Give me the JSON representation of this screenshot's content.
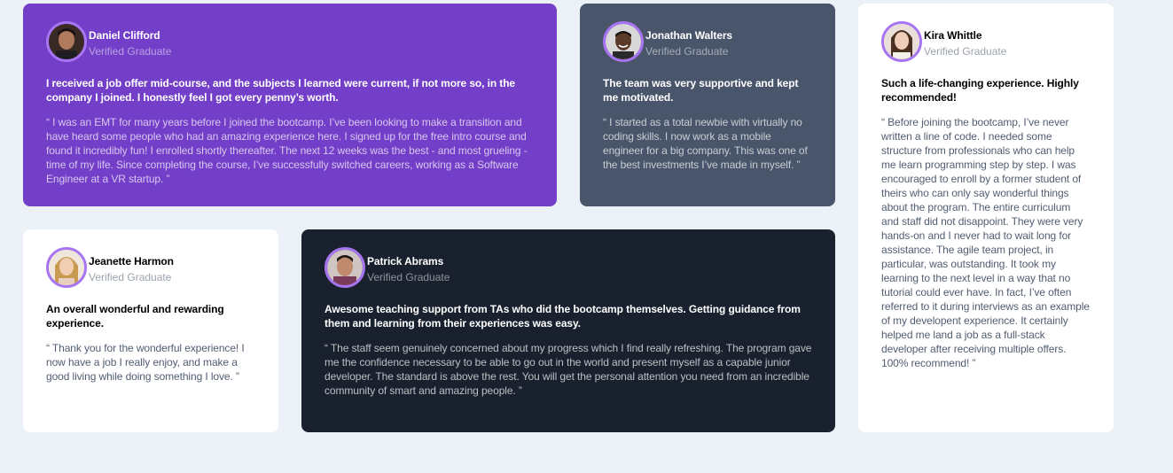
{
  "colors": {
    "background": "#ECF1F8",
    "purple": "#733FC8",
    "slate": "#48556A",
    "white": "#FFFFFF",
    "dark": "#19212E",
    "avatar_ring": "#A775F1"
  },
  "testimonials": [
    {
      "name": "Daniel Clifford",
      "role": "Verified Graduate",
      "avatar": "daniel-avatar",
      "summary": "I received a job offer mid-course, and the subjects I learned were current, if not more so, in the company I joined. I honestly feel I got every penny’s worth.",
      "quote": "“ I was an EMT for many years before I joined the bootcamp. I’ve been looking to make a transition and have heard some people who had an amazing experience here. I signed up for the free intro course and found it incredibly fun! I enrolled shortly thereafter. The next 12 weeks was the best - and most grueling - time of my life. Since completing the course, I’ve successfully switched careers, working as a Software Engineer at a VR startup. ”"
    },
    {
      "name": "Jonathan Walters",
      "role": "Verified Graduate",
      "avatar": "jonathan-avatar",
      "summary": "The team was very supportive and kept me motivated.",
      "quote": "“ I started as a total newbie with virtually no coding skills. I now work as a mobile engineer for a big company. This was one of the best investments I’ve made in myself. ”"
    },
    {
      "name": "Kira Whittle",
      "role": "Verified Graduate",
      "avatar": "kira-avatar",
      "summary": "Such a life-changing experience. Highly recommended!",
      "quote": "“ Before joining the bootcamp, I’ve never written a line of code. I needed some structure from professionals who can help me learn programming step by step. I was encouraged to enroll by a former student of theirs who can only say wonderful things about the program. The entire curriculum and staff did not disappoint. They were very hands-on and I never had to wait long for assistance. The agile team project, in particular, was outstanding. It took my learning to the next level in a way that no tutorial could ever have. In fact, I’ve often referred to it during interviews as an example of my developent experience. It certainly helped me land a job as a full-stack developer after receiving multiple offers. 100% recommend! ”"
    },
    {
      "name": "Jeanette Harmon",
      "role": "Verified Graduate",
      "avatar": "jeanette-avatar",
      "summary": "An overall wonderful and rewarding experience.",
      "quote": "“ Thank you for the wonderful experience! I now have a job I really enjoy, and make a good living while doing something I love. ”"
    },
    {
      "name": "Patrick Abrams",
      "role": "Verified Graduate",
      "avatar": "patrick-avatar",
      "summary": "Awesome teaching support from TAs who did the bootcamp themselves. Getting guidance from them and learning from their experiences was easy.",
      "quote": "“ The staff seem genuinely concerned about my progress which I find really refreshing. The program gave me the confidence necessary to be able to go out in the world and present myself as a capable junior developer. The standard is above the rest. You will get the personal attention you need from an incredible community of smart and amazing people. ”"
    }
  ]
}
